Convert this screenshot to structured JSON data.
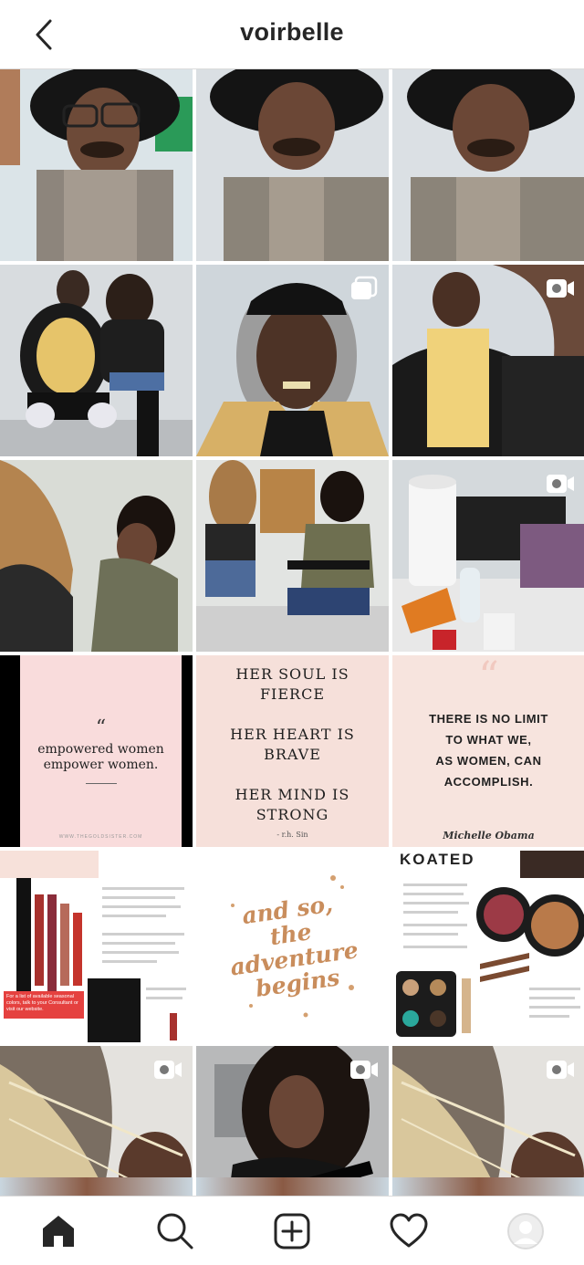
{
  "header": {
    "title": "voirbelle",
    "back_icon": "chevron-left-icon"
  },
  "posts": [
    {
      "id": "p1",
      "kind": "photo",
      "subject": "man-with-afro-and-glasses"
    },
    {
      "id": "p2",
      "kind": "photo",
      "subject": "man-eyes-closed"
    },
    {
      "id": "p3",
      "kind": "photo",
      "subject": "man-eyes-closed"
    },
    {
      "id": "p4",
      "kind": "photo",
      "subject": "two-people-posing"
    },
    {
      "id": "p5",
      "kind": "carousel",
      "subject": "old-man-in-cap"
    },
    {
      "id": "p6",
      "kind": "video",
      "subject": "makeup-application"
    },
    {
      "id": "p7",
      "kind": "photo",
      "subject": "makeup-application-closeup"
    },
    {
      "id": "p8",
      "kind": "photo",
      "subject": "makeup-artist-at-chair"
    },
    {
      "id": "p9",
      "kind": "video",
      "subject": "makeup-table-supplies"
    },
    {
      "id": "p10",
      "kind": "quote",
      "quote_mark": "“",
      "text": "empowered women\nempower women.",
      "footer": "WWW.THEGOLDSISTER.COM"
    },
    {
      "id": "p11",
      "kind": "quote",
      "text": "HER SOUL IS\nFIERCE\n\nHER HEART IS\nBRAVE\n\nHER MIND IS\nSTRONG",
      "signature": "- r.h. Sin"
    },
    {
      "id": "p12",
      "kind": "quote",
      "quote_mark": "“",
      "text": "THERE IS NO LIMIT\nTO WHAT WE,\nAS WOMEN, CAN\nACCOMPLISH.",
      "signature": "Michelle Obama"
    },
    {
      "id": "p13",
      "kind": "product-sheet",
      "subject": "lip-products",
      "promo": "For a list of available seasonal colors, talk to your Consultant or visit our website."
    },
    {
      "id": "p14",
      "kind": "quote",
      "text": "and so,\nthe\nadventure\nbegins"
    },
    {
      "id": "p15",
      "kind": "product-sheet",
      "heading": "KOATED",
      "subject": "eye-and-cheek-products"
    },
    {
      "id": "p16",
      "kind": "video",
      "subject": "woman-hair-closeup"
    },
    {
      "id": "p17",
      "kind": "video",
      "subject": "woman-with-curly-hair"
    },
    {
      "id": "p18",
      "kind": "video",
      "subject": "woman-hair-closeup"
    },
    {
      "id": "p19",
      "kind": "photo",
      "subject": "partial-row"
    },
    {
      "id": "p20",
      "kind": "photo",
      "subject": "partial-row"
    },
    {
      "id": "p21",
      "kind": "photo",
      "subject": "partial-row"
    }
  ],
  "nav": {
    "items": [
      {
        "name": "home",
        "icon": "home-icon",
        "active": true
      },
      {
        "name": "search",
        "icon": "search-icon",
        "active": false
      },
      {
        "name": "new-post",
        "icon": "add-post-icon",
        "active": false
      },
      {
        "name": "activity",
        "icon": "heart-icon",
        "active": false
      },
      {
        "name": "profile",
        "icon": "avatar-icon",
        "active": false
      }
    ]
  },
  "colors": {
    "text": "#262626",
    "border": "#dbdbdb",
    "accent_gold": "#c98d5c",
    "quote_pink": "#f9dcdc"
  }
}
